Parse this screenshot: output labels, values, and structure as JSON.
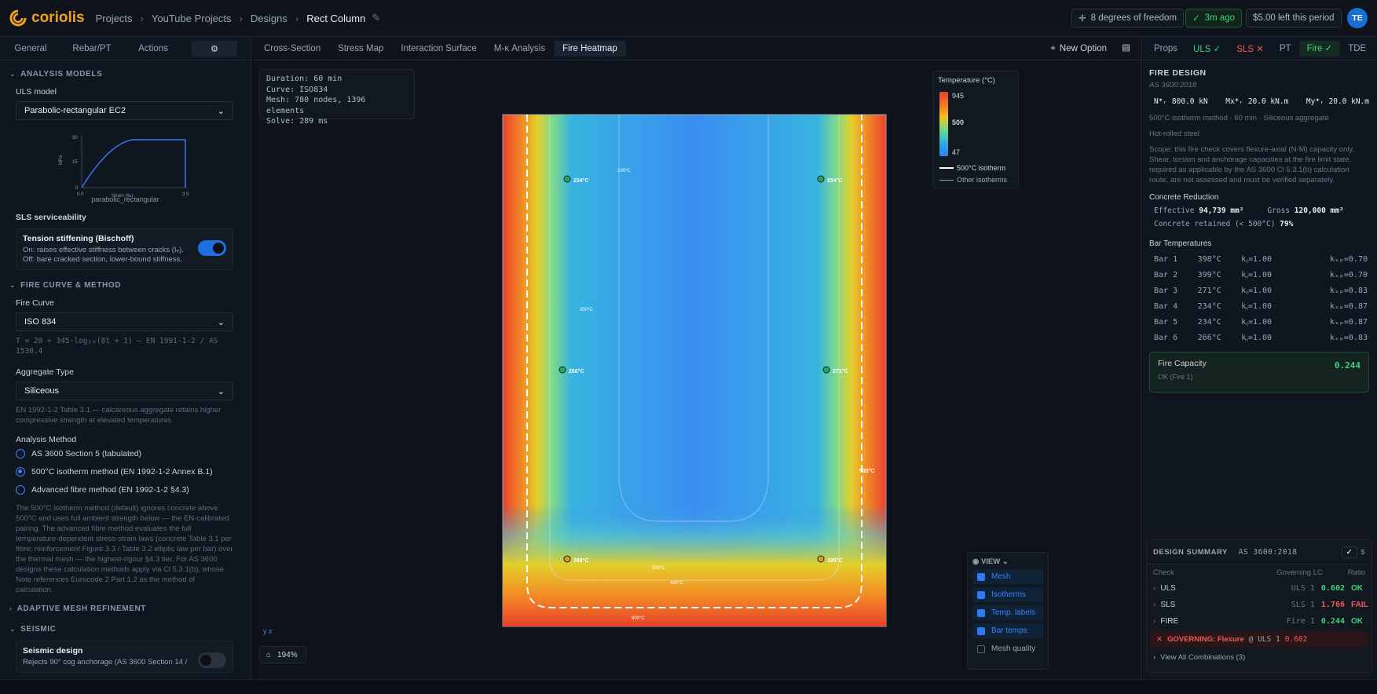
{
  "app": {
    "name": "coriolis",
    "breadcrumbs": [
      "Projects",
      "YouTube Projects",
      "Designs",
      "Rect Column"
    ],
    "dof": "8 degrees of freedom",
    "saved": "3m ago",
    "credits": "$5.00 left this period",
    "user": "TE"
  },
  "left": {
    "tabs": [
      "General",
      "Rebar/PT",
      "Actions"
    ],
    "analysis_models": "ANALYSIS MODELS",
    "uls_model_label": "ULS model",
    "uls_model": "Parabolic-rectangular EC2",
    "chart": {
      "y_label": "MPa",
      "x_label": "Strain (‰)",
      "y_ticks": [
        "30",
        "15",
        "0"
      ],
      "x_ticks": [
        "0.0",
        "3.5"
      ],
      "caption": "parabolic_rectangular"
    },
    "sls_label": "SLS serviceability",
    "tension_title": "Tension stiffening (Bischoff)",
    "tension_on": "On: raises effective stiffness between cracks (Iₑ).",
    "tension_off": "Off: bare cracked section, lower-bound stiffness.",
    "fire_section": "FIRE CURVE & METHOD",
    "fire_curve_label": "Fire Curve",
    "fire_curve": "ISO 834",
    "fire_formula": "T = 20 + 345·log₁₀(8t + 1) — EN 1991-1-2 / AS 1530.4",
    "agg_label": "Aggregate Type",
    "agg": "Siliceous",
    "agg_hint": "EN 1992-1-2 Table 3.1 — calcareous aggregate retains higher compressive strength at elevated temperatures.",
    "method_label": "Analysis Method",
    "methods": [
      "AS 3600 Section 5 (tabulated)",
      "500°C isotherm method (EN 1992-1-2 Annex B.1)",
      "Advanced fibre method (EN 1992-1-2 §4.3)"
    ],
    "method_hint": "The 500°C isotherm method (default) ignores concrete above 500°C and uses full ambient strength below — the EN-calibrated pairing. The advanced fibre method evaluates the full temperature-dependent stress-strain laws (concrete Table 3.1 per fibre; reinforcement Figure 3.3 / Table 3.2 elliptic law per bar) over the thermal mesh — the highest-rigour §4.3 tier. For AS 3600 designs these calculation methods apply via Cl 5.3.1(b), whose Note references Eurocode 2 Part 1.2 as the method of calculation.",
    "mesh_section": "ADAPTIVE MESH REFINEMENT",
    "seismic_section": "SEISMIC",
    "seismic_title": "Seismic design",
    "seismic_desc": "Rejects 90° cog anchorage (AS 3600 Section 14 /"
  },
  "center": {
    "tabs": [
      "Cross-Section",
      "Stress Map",
      "Interaction Surface",
      "M-κ Analysis",
      "Fire Heatmap"
    ],
    "new_option": "New Option",
    "info": [
      "Duration: 60 min",
      "Curve: ISO834",
      "Mesh: 780 nodes, 1396 elements",
      "Solve: 289 ms"
    ],
    "legend": {
      "title": "Temperature (°C)",
      "max": "945",
      "mid": "500",
      "min": "47",
      "iso500": "500°C isotherm",
      "other": "Other isotherms"
    },
    "bar_labels": [
      "234°C",
      "234°C",
      "266°C",
      "271°C",
      "398°C",
      "399°C"
    ],
    "iso_labels": [
      "100°C",
      "200°C",
      "500°C",
      "300°C",
      "400°C",
      "800°C"
    ],
    "view": {
      "title": "VIEW",
      "options": [
        "Mesh",
        "Isotherms",
        "Temp. labels",
        "Bar temps",
        "Mesh quality"
      ]
    },
    "zoom": "194%",
    "axis": "y x"
  },
  "right": {
    "tabs": [
      "Props",
      "ULS",
      "SLS",
      "PT",
      "Fire",
      "TDE"
    ],
    "title": "FIRE DESIGN",
    "code": "AS 3600:2018",
    "forces": [
      "N*ᵣ 800.0 kN",
      "Mx*ᵣ 20.0 kN.m",
      "My*ᵣ 20.0 kN.m"
    ],
    "meta": [
      "500°C isotherm method",
      "60 min",
      "Siliceous aggregate",
      "Hot-rolled steel"
    ],
    "scope": "Scope: this fire check covers flexure-axial (N-M) capacity only. Shear, torsion and anchorage capacities at the fire limit state, required as applicable by the AS 3600 Cl 5.3.1(b) calculation route, are not assessed and must be verified separately.",
    "reduction_label": "Concrete Reduction",
    "effective": "94,739 mm²",
    "gross": "120,000 mm²",
    "retained": "79%",
    "effective_label": "Effective",
    "gross_label": "Gross",
    "retained_label": "Concrete retained (< 500°C)",
    "bars_label": "Bar Temperatures",
    "bars": [
      [
        "Bar 1",
        "398°C",
        "kᵧ=1.00",
        "kₛₚ=0.70"
      ],
      [
        "Bar 2",
        "399°C",
        "kᵧ=1.00",
        "kₛₚ=0.70"
      ],
      [
        "Bar 3",
        "271°C",
        "kᵧ=1.00",
        "kₛₚ=0.83"
      ],
      [
        "Bar 4",
        "234°C",
        "kᵧ=1.00",
        "kₛₚ=0.87"
      ],
      [
        "Bar 5",
        "234°C",
        "kᵧ=1.00",
        "kₛₚ=0.87"
      ],
      [
        "Bar 6",
        "266°C",
        "kᵧ=1.00",
        "kₛₚ=0.83"
      ]
    ],
    "capacity_label": "Fire Capacity",
    "capacity": "0.244",
    "capacity_status": "OK (Fire 1)",
    "summary": {
      "title": "DESIGN SUMMARY",
      "code": "AS 3600:2018",
      "cols": [
        "Check",
        "Governing LC",
        "Ratio"
      ],
      "rows": [
        [
          "ULS",
          "ULS 1",
          "0.602",
          "OK"
        ],
        [
          "SLS",
          "SLS 1",
          "1.766",
          "FAIL"
        ],
        [
          "FIRE",
          "Fire 1",
          "0.244",
          "OK"
        ]
      ],
      "governing": "GOVERNING: Flexure",
      "governing_lc": "@ ULS 1",
      "governing_ratio": "0.602",
      "all": "View All Combinations (3)"
    }
  }
}
